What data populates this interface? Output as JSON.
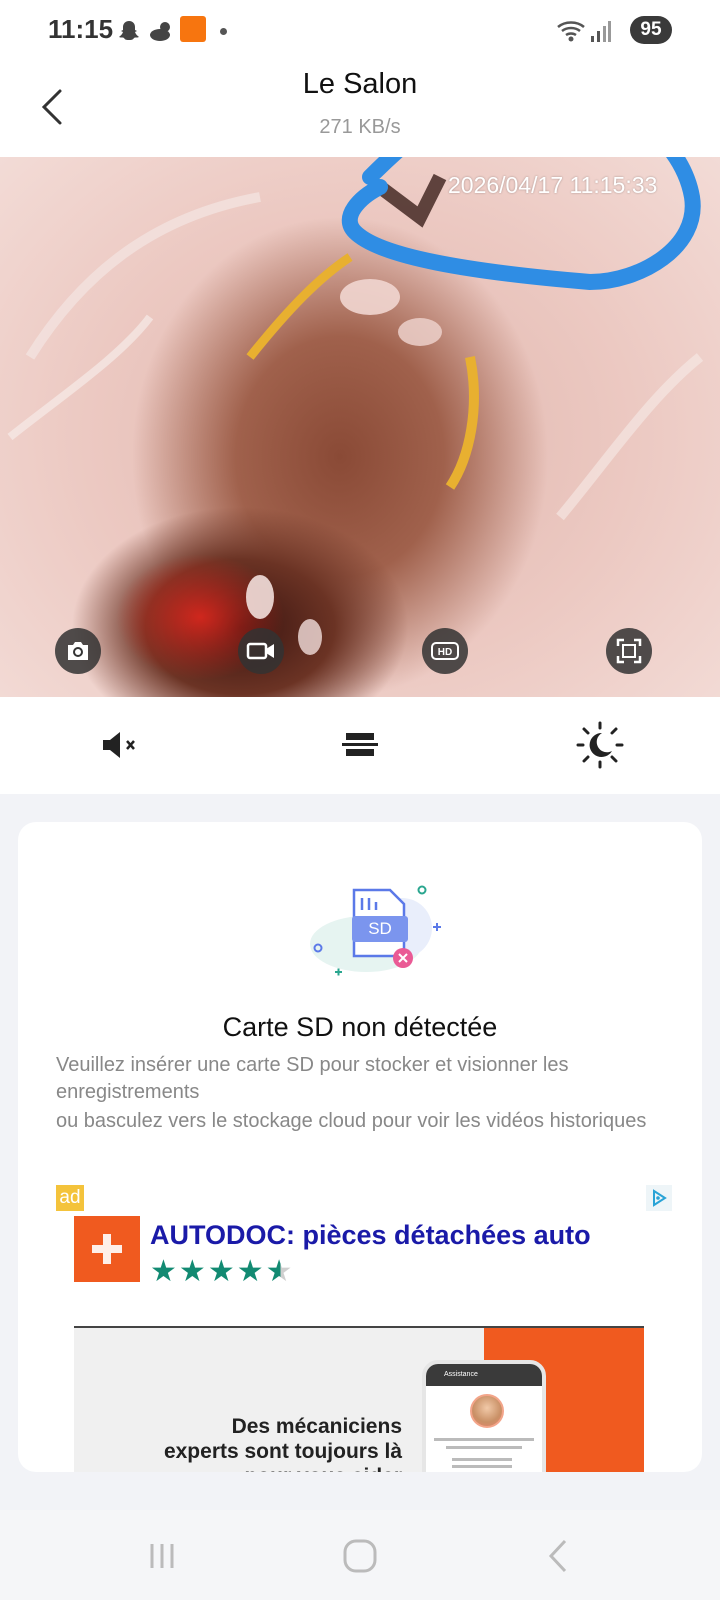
{
  "status_bar": {
    "time": "11:15",
    "battery": "95",
    "icons": [
      "snapchat-icon",
      "weather-icon",
      "temu-icon",
      "dot-icon",
      "wifi-icon",
      "signal-icon"
    ]
  },
  "header": {
    "title": "Le Salon",
    "bitrate": "271 KB/s"
  },
  "video": {
    "timestamp": "2026/04/17 11:15:33",
    "buttons": [
      "camera-icon",
      "record-icon",
      "hd-icon",
      "fullscreen-icon"
    ]
  },
  "controls": [
    "mute-icon",
    "layout-icon",
    "night-mode-icon"
  ],
  "sd_card": {
    "badge": "SD",
    "title": "Carte SD non détectée",
    "line1": "Veuillez insérer une carte SD pour stocker et visionner les enregistrements",
    "line2": "ou basculez vers le stockage cloud pour voir les vidéos historiques"
  },
  "ad": {
    "label": "ad",
    "title": "AUTODOC: pièces détachées auto",
    "rating_stars": 4.5,
    "stars_text": "★★★★★",
    "headline": "Des mécaniciens experts sont toujours là pour vous aider",
    "phone_header": "Assistance"
  },
  "colors": {
    "accent_blue": "#2f8de4",
    "ad_title": "#1a1aa8",
    "autodoc_orange": "#f05a1f",
    "star_green": "#128a72"
  }
}
